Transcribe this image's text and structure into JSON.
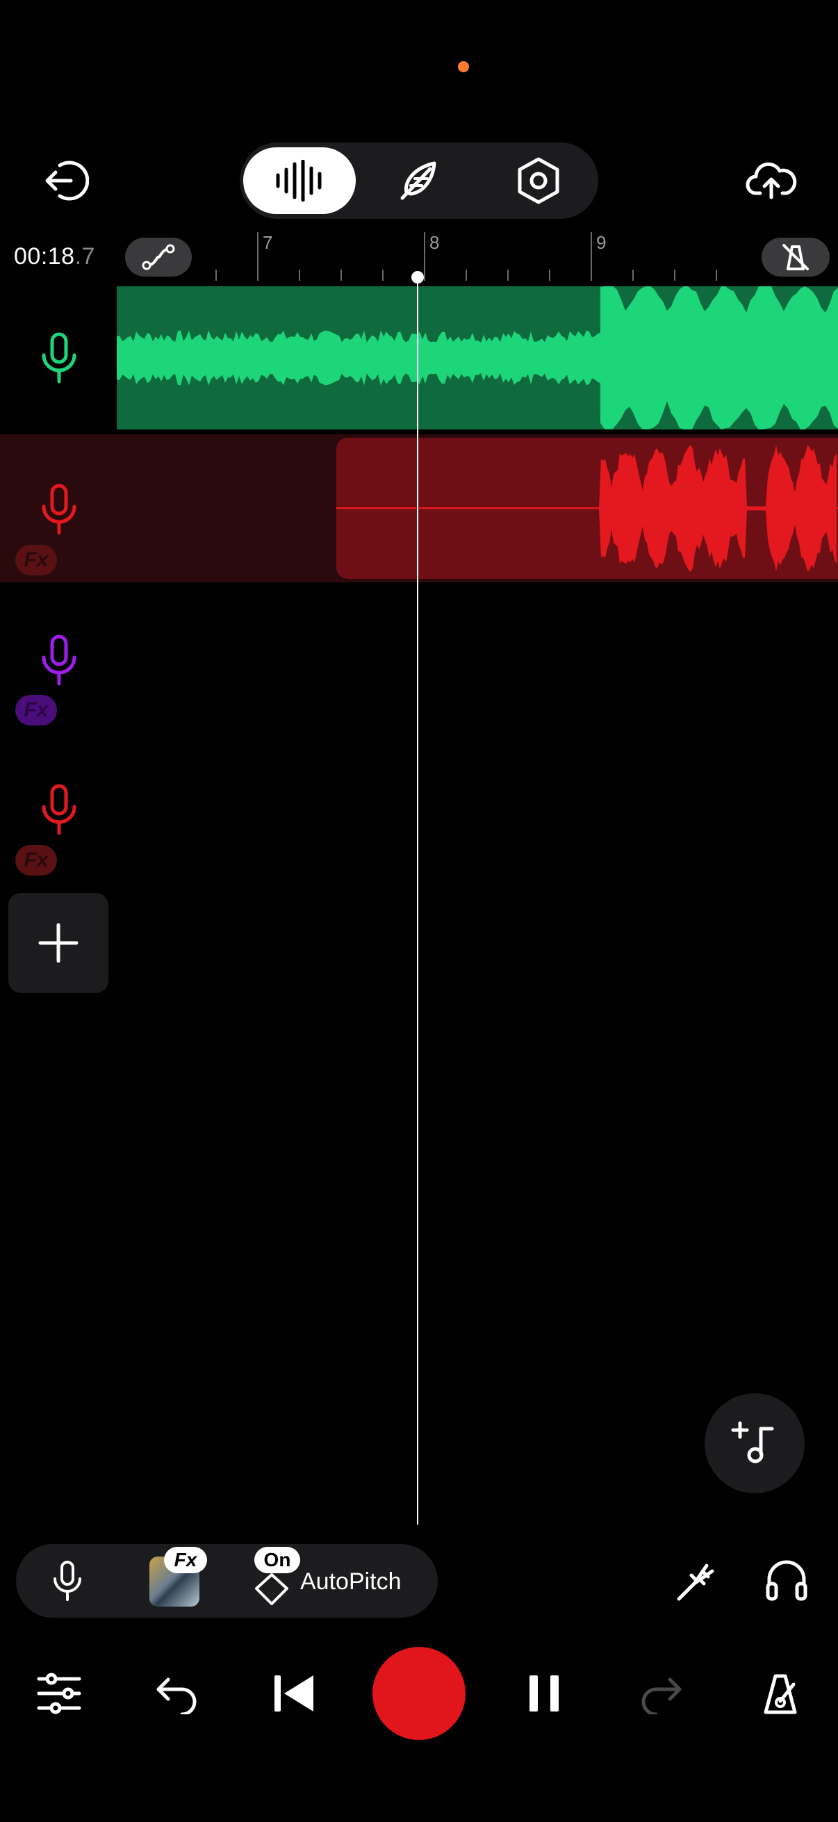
{
  "status": {
    "dot_color": "#ff7a2f"
  },
  "header": {
    "back_icon": "exit-icon",
    "modes": [
      {
        "icon": "waveform-icon",
        "active": true
      },
      {
        "icon": "feather-icon",
        "active": false
      },
      {
        "icon": "settings-hex-icon",
        "active": false
      }
    ],
    "upload_icon": "cloud-upload-icon"
  },
  "ruler": {
    "time_main": "00:18",
    "time_frac": ".7",
    "marks": [
      "7",
      "8",
      "9"
    ],
    "automation_icon": "automation-curve-icon",
    "metronome_icon": "metronome-off-icon"
  },
  "tracks": [
    {
      "name": "track-1",
      "color": "#1ed67a",
      "fx": false
    },
    {
      "name": "track-2",
      "color": "#e3191f",
      "fx": true,
      "fx_label": "Fx"
    },
    {
      "name": "track-3",
      "color": "#9b1fe8",
      "fx": true,
      "fx_label": "Fx"
    },
    {
      "name": "track-4",
      "color": "#e3191f",
      "fx": true,
      "fx_label": "Fx"
    }
  ],
  "input_bar": {
    "fx_badge": "Fx",
    "on_badge": "On",
    "autopitch_label": "AutoPitch"
  },
  "transport": {
    "record_color": "#e0161c",
    "icons": [
      "mixer-sliders-icon",
      "undo-icon",
      "skip-back-icon",
      "record-icon",
      "pause-icon",
      "redo-icon",
      "metronome-icon"
    ]
  }
}
